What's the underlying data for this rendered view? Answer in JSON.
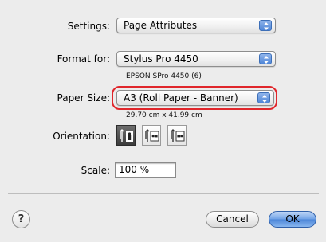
{
  "settings": {
    "label": "Settings:",
    "value": "Page Attributes"
  },
  "format_for": {
    "label": "Format for:",
    "value": "Stylus Pro 4450",
    "subtext": "EPSON SPro 4450 (6)"
  },
  "paper_size": {
    "label": "Paper Size:",
    "value": "A3 (Roll Paper - Banner)",
    "subtext": "29.70 cm x 41.99 cm"
  },
  "orientation": {
    "label": "Orientation:",
    "options": [
      {
        "name": "portrait",
        "selected": true
      },
      {
        "name": "landscape-left",
        "selected": false
      },
      {
        "name": "landscape-right",
        "selected": false
      }
    ]
  },
  "scale": {
    "label": "Scale:",
    "value": "100 %"
  },
  "buttons": {
    "help": "?",
    "cancel": "Cancel",
    "ok": "OK"
  },
  "colors": {
    "highlight": "#e0262b",
    "stepper_blue": "#4f86d8"
  }
}
